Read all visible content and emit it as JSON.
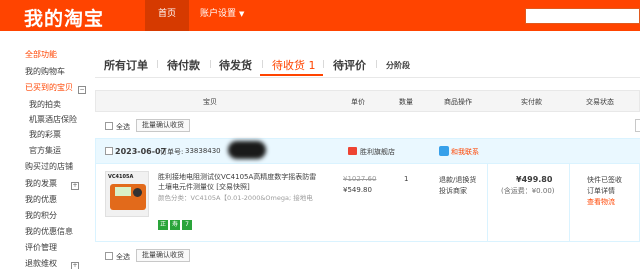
{
  "header": {
    "logo": "我的淘宝",
    "nav_home": "首页",
    "nav_settings": "账户设置",
    "colors": {
      "brand": "#ff4400",
      "nav_active": "#d63a00"
    }
  },
  "sidebar": {
    "all_functions": "全部功能",
    "cart": "我的购物车",
    "bought": "已买到的宝贝",
    "auction": "我的拍卖",
    "ticket_insurance": "机票酒店保险",
    "lottery": "我的彩票",
    "official_recycle": "官方集运",
    "visited_shops": "购买过的店铺",
    "my_invoice": "我的发票",
    "my_coupons": "我的优惠",
    "my_points": "我的积分",
    "my_reviews": "我的优惠信息",
    "review_mgmt": "评价管理",
    "refund": "退款维权"
  },
  "tabs": {
    "all_orders": "所有订单",
    "to_pay": "待付款",
    "to_ship": "待发货",
    "to_receive": "待收货 1",
    "to_review": "待评价",
    "installments": "分阶段"
  },
  "table_header": {
    "item": "宝贝",
    "unit_price": "单价",
    "quantity": "数量",
    "item_op": "商品操作",
    "paid": "实付款",
    "status": "交易状态"
  },
  "batch": {
    "select_all": "全选",
    "confirm_receipt": "批量确认收货"
  },
  "order": {
    "date": "2023-06-07",
    "order_no_label": "订单号:",
    "order_no": "33838430",
    "shop_name": "胜利旗舰店",
    "contact": "和我联系",
    "thumb_label": "VC4105A",
    "item_title": "胜利接地电阻测试仪VC4105A高精度数字摇表防雷土壤电元件测量仪 [交易快照]",
    "item_spec": "颜色分类：VC4105A【0.01-2000&Omega; 接地电",
    "badges": [
      "正",
      "寿",
      "7"
    ],
    "price_old": "¥1027.60",
    "price_new": "¥549.80",
    "quantity": "1",
    "op_refund": "退款/退换货",
    "op_complain": "投诉商家",
    "paid": "¥499.80",
    "postage": "(含运费：¥0.00)",
    "status_shipped": "快件已签收",
    "status_detail": "订单详情",
    "status_logistics": "查看物流"
  }
}
